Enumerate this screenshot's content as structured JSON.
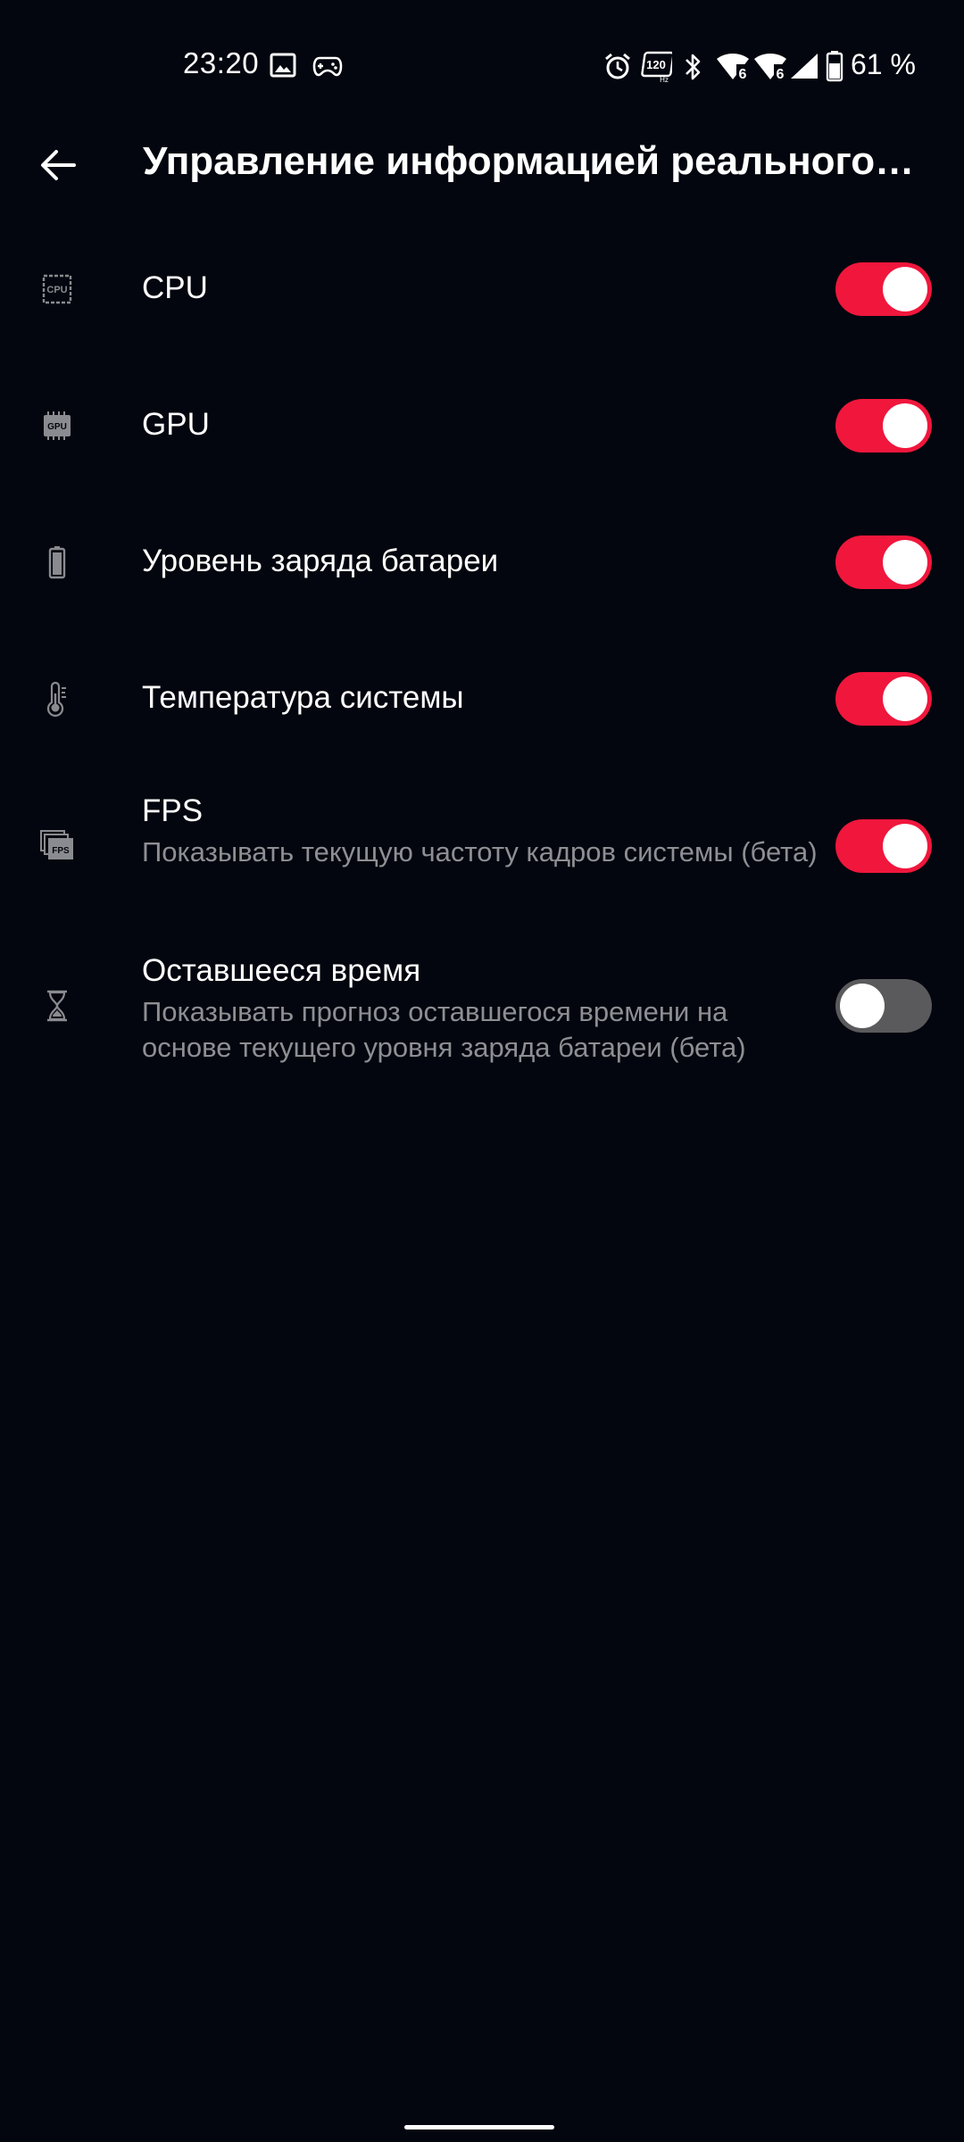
{
  "status_bar": {
    "time": "23:20",
    "battery_percent": "61 %",
    "refresh_rate_badge": "120",
    "refresh_rate_unit": "Hz",
    "wifi_badge": "6"
  },
  "app_bar": {
    "title": "Управление информацией реального…"
  },
  "settings": [
    {
      "icon_text": "CPU",
      "title": "CPU",
      "summary": "",
      "enabled": true
    },
    {
      "icon_text": "GPU",
      "title": "GPU",
      "summary": "",
      "enabled": true
    },
    {
      "title": "Уровень заряда батареи",
      "summary": "",
      "enabled": true
    },
    {
      "title": "Температура системы",
      "summary": "",
      "enabled": true
    },
    {
      "icon_text": "FPS",
      "title": "FPS",
      "summary": "Показывать текущую частоту кадров системы (бета)",
      "enabled": true
    },
    {
      "title": "Оставшееся время",
      "summary": "Показывать прогноз оставшегося времени на основе текущего уровня заряда батареи (бета)",
      "enabled": false
    }
  ],
  "colors": {
    "background": "#03060e",
    "toggle_on": "#f0163c",
    "toggle_off": "#5a5a5c",
    "summary_text": "#8e8f94"
  }
}
